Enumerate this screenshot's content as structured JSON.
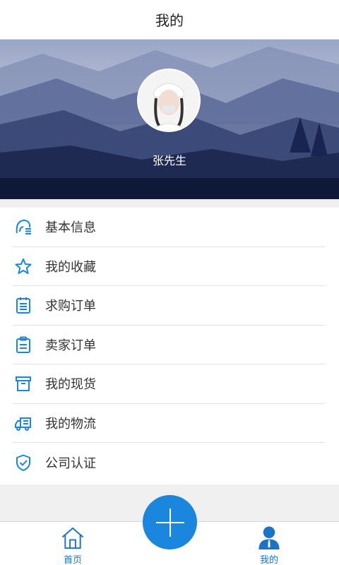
{
  "header": {
    "title": "我的"
  },
  "profile": {
    "name": "张先生"
  },
  "menu": {
    "items": [
      {
        "label": "基本信息",
        "icon": "user-info-icon"
      },
      {
        "label": "我的收藏",
        "icon": "star-icon"
      },
      {
        "label": "求购订单",
        "icon": "list-document-icon"
      },
      {
        "label": "卖家订单",
        "icon": "clipboard-icon"
      },
      {
        "label": "我的现货",
        "icon": "archive-box-icon"
      },
      {
        "label": "我的物流",
        "icon": "truck-icon"
      },
      {
        "label": "公司认证",
        "icon": "shield-check-icon"
      }
    ]
  },
  "tabbar": {
    "home_label": "首页",
    "mine_label": "我的"
  },
  "colors": {
    "accent": "#1a86de",
    "tab_text": "#1a73c9"
  }
}
